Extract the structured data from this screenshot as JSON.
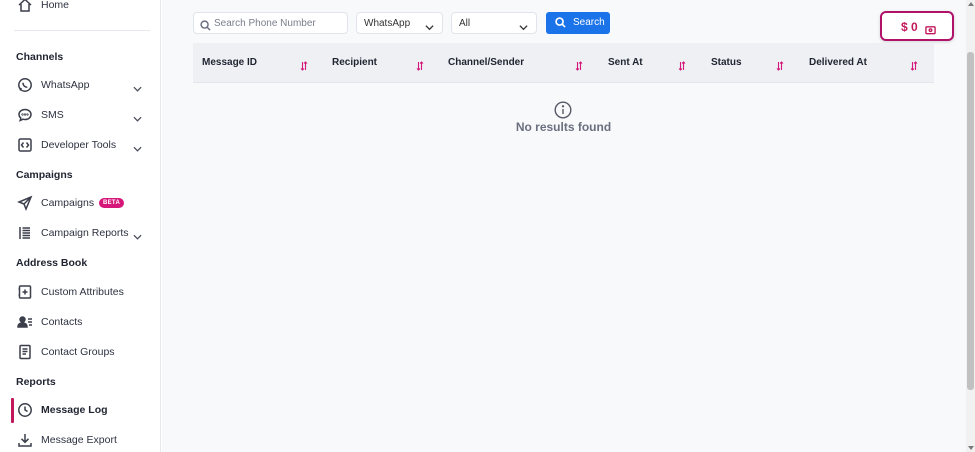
{
  "sidebar": {
    "home": {
      "label": "Home",
      "icon": "home-icon"
    },
    "sections": {
      "channels": "Channels",
      "campaigns": "Campaigns",
      "address_book": "Address Book",
      "reports": "Reports"
    },
    "items": {
      "whatsapp": {
        "label": "WhatsApp",
        "icon": "whatsapp-icon"
      },
      "sms": {
        "label": "SMS",
        "icon": "chat-bubble-icon"
      },
      "developer_tools": {
        "label": "Developer Tools",
        "icon": "code-icon"
      },
      "campaigns": {
        "label": "Campaigns",
        "icon": "send-icon",
        "badge": "BETA"
      },
      "campaign_reports": {
        "label": "Campaign Reports",
        "icon": "list-icon"
      },
      "custom_attributes": {
        "label": "Custom Attributes",
        "icon": "attribute-icon"
      },
      "contacts": {
        "label": "Contacts",
        "icon": "contacts-icon"
      },
      "contact_groups": {
        "label": "Contact Groups",
        "icon": "document-icon"
      },
      "message_log": {
        "label": "Message Log",
        "icon": "clock-icon",
        "active": true
      },
      "message_export": {
        "label": "Message Export",
        "icon": "download-icon"
      }
    }
  },
  "filters": {
    "search_placeholder": "Search Phone Number",
    "search_value": "",
    "channel_selected": "WhatsApp",
    "status_selected": "All",
    "search_button": "Search"
  },
  "wallet": {
    "amount": "$ 0"
  },
  "table": {
    "columns": [
      "Message ID",
      "Recipient",
      "Channel/Sender",
      "Sent At",
      "Status",
      "Delivered At"
    ],
    "empty_message": "No results found"
  },
  "colors": {
    "accent": "#c2185b",
    "primary_button": "#1a73e8",
    "badge": "#d6177a"
  }
}
